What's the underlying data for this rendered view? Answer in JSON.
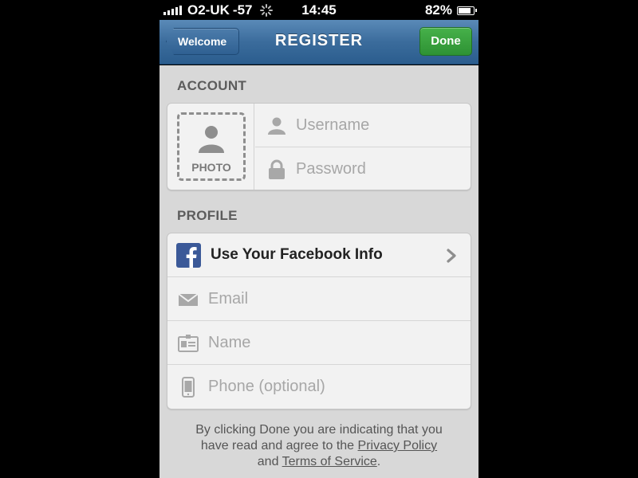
{
  "status_bar": {
    "carrier": "O2-UK",
    "signal_strength": "-57",
    "time": "14:45",
    "battery": "82%",
    "battery_level": 0.82
  },
  "nav": {
    "back_label": "Welcome",
    "title": "REGISTER",
    "done_label": "Done",
    "accent_color": "#3b6c9c",
    "done_color": "#36a03c"
  },
  "account": {
    "header": "ACCOUNT",
    "photo_label": "PHOTO",
    "username_placeholder": "Username",
    "password_placeholder": "Password",
    "icons": [
      "person-icon",
      "lock-icon"
    ]
  },
  "profile": {
    "header": "PROFILE",
    "facebook_label": "Use Your Facebook Info",
    "email_placeholder": "Email",
    "name_placeholder": "Name",
    "phone_placeholder": "Phone (optional)",
    "icons": [
      "facebook-icon",
      "envelope-icon",
      "id-card-icon",
      "phone-icon",
      "chevron-right-icon"
    ]
  },
  "footer": {
    "text_1": "By clicking Done you are indicating that you",
    "text_2": "have read and agree to the",
    "privacy_link": "Privacy Policy",
    "text_3": "and",
    "terms_link": "Terms of Service",
    "text_4": "."
  }
}
